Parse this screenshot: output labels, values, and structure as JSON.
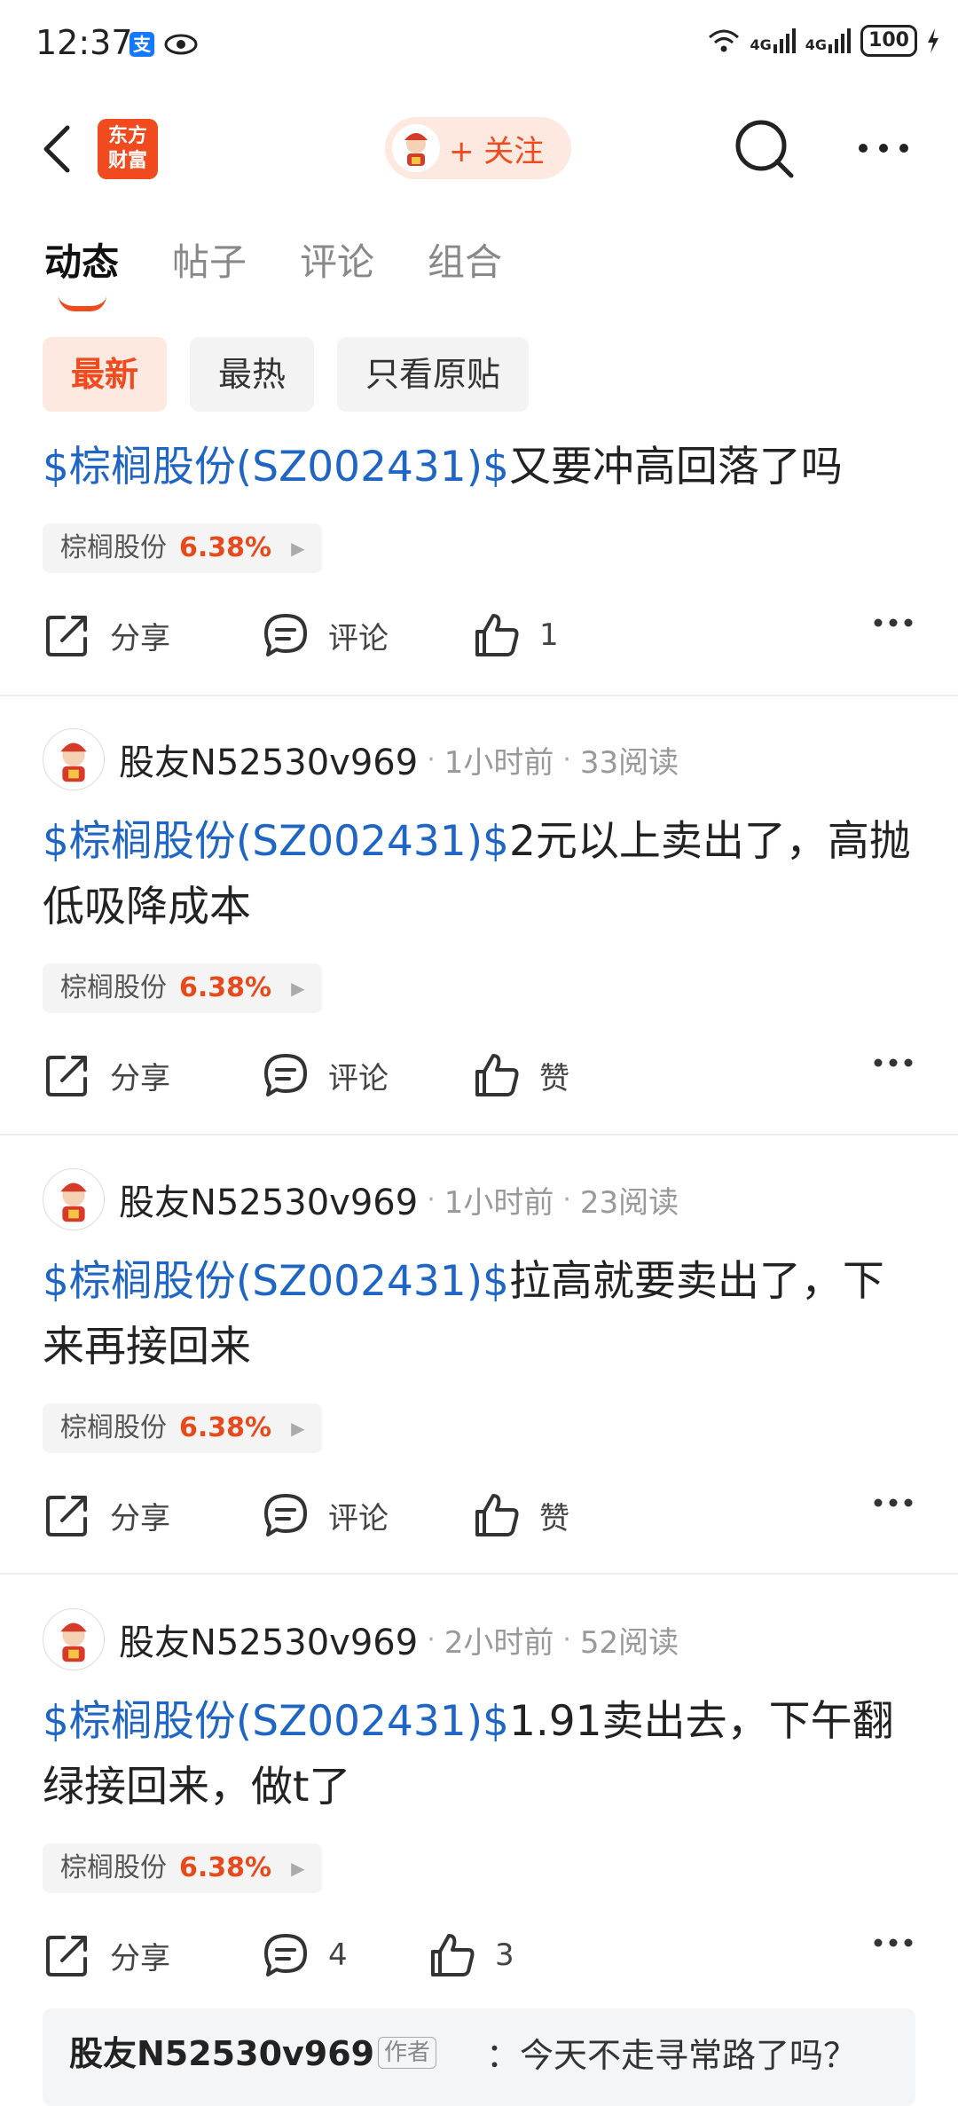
{
  "status_bar": {
    "time": "12:37",
    "battery": "100",
    "network_1": "4G",
    "network_2": "4G"
  },
  "header": {
    "logo_line1": "东方",
    "logo_line2": "财富",
    "follow_label": "+ 关注"
  },
  "tabs": [
    "动态",
    "帖子",
    "评论",
    "组合"
  ],
  "filters": [
    "最新",
    "最热",
    "只看原贴"
  ],
  "share_label": "分享",
  "posts": [
    {
      "stock_link": "$棕榈股份(SZ002431)$",
      "text": "又要冲高回落了吗",
      "tag_name": "棕榈股份",
      "tag_pct": "6.38%",
      "comment_label": "评论",
      "like_label": "1"
    },
    {
      "author": "股友N52530v969",
      "time": "1小时前",
      "reads": "33阅读",
      "stock_link": "$棕榈股份(SZ002431)$",
      "text": "2元以上卖出了，高抛低吸降成本",
      "tag_name": "棕榈股份",
      "tag_pct": "6.38%",
      "comment_label": "评论",
      "like_label": "赞"
    },
    {
      "author": "股友N52530v969",
      "time": "1小时前",
      "reads": "23阅读",
      "stock_link": "$棕榈股份(SZ002431)$",
      "text": "拉高就要卖出了，下来再接回来",
      "tag_name": "棕榈股份",
      "tag_pct": "6.38%",
      "comment_label": "评论",
      "like_label": "赞"
    },
    {
      "author": "股友N52530v969",
      "time": "2小时前",
      "reads": "52阅读",
      "stock_link": "$棕榈股份(SZ002431)$",
      "text": "1.91卖出去，下午翻绿接回来，做t了",
      "tag_name": "棕榈股份",
      "tag_pct": "6.38%",
      "comment_label": "4",
      "like_label": "3"
    }
  ],
  "reply": {
    "author": "股友N52530v969",
    "badge": "作者",
    "text": "：今天不走寻常路了吗？"
  }
}
